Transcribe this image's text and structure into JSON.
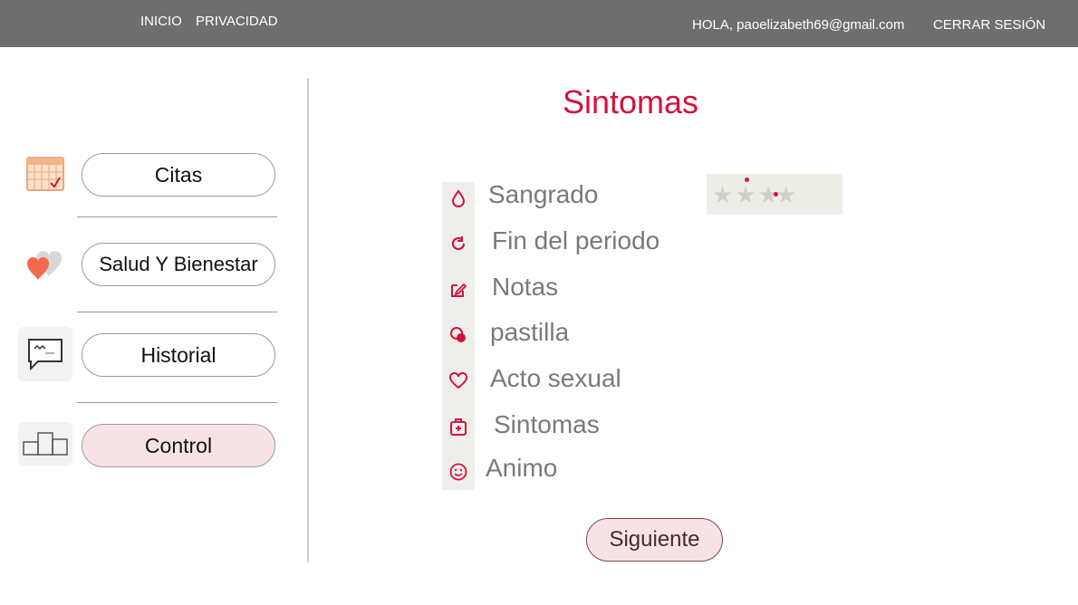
{
  "header": {
    "nav": [
      "INICIO",
      "PRIVACIDAD"
    ],
    "greeting": "HOLA, paoelizabeth69@gmail.com",
    "logout": "CERRAR SESIÓN"
  },
  "sidebar": {
    "items": [
      {
        "label": "Citas",
        "icon": "calendar-icon"
      },
      {
        "label": "Salud Y Bienestar",
        "icon": "heart-icon"
      },
      {
        "label": "Historial",
        "icon": "chat-icon"
      },
      {
        "label": "Control",
        "icon": "podium-icon"
      }
    ],
    "active": "Control"
  },
  "main": {
    "title": "Sintomas",
    "symptoms": [
      {
        "label": "Sangrado",
        "icon": "drop-icon"
      },
      {
        "label": "Fin del periodo",
        "icon": "refresh-icon"
      },
      {
        "label": "Notas",
        "icon": "edit-icon"
      },
      {
        "label": "pastilla",
        "icon": "pill-icon"
      },
      {
        "label": "Acto sexual",
        "icon": "heart-outline-icon"
      },
      {
        "label": "Sintomas",
        "icon": "first-aid-icon"
      },
      {
        "label": "Animo",
        "icon": "smile-icon"
      }
    ],
    "rating": {
      "max": 4
    },
    "next_label": "Siguiente"
  },
  "colors": {
    "accent": "#d4123f",
    "topbar": "#6e6e6e",
    "active_button": "#f7e3e5"
  }
}
